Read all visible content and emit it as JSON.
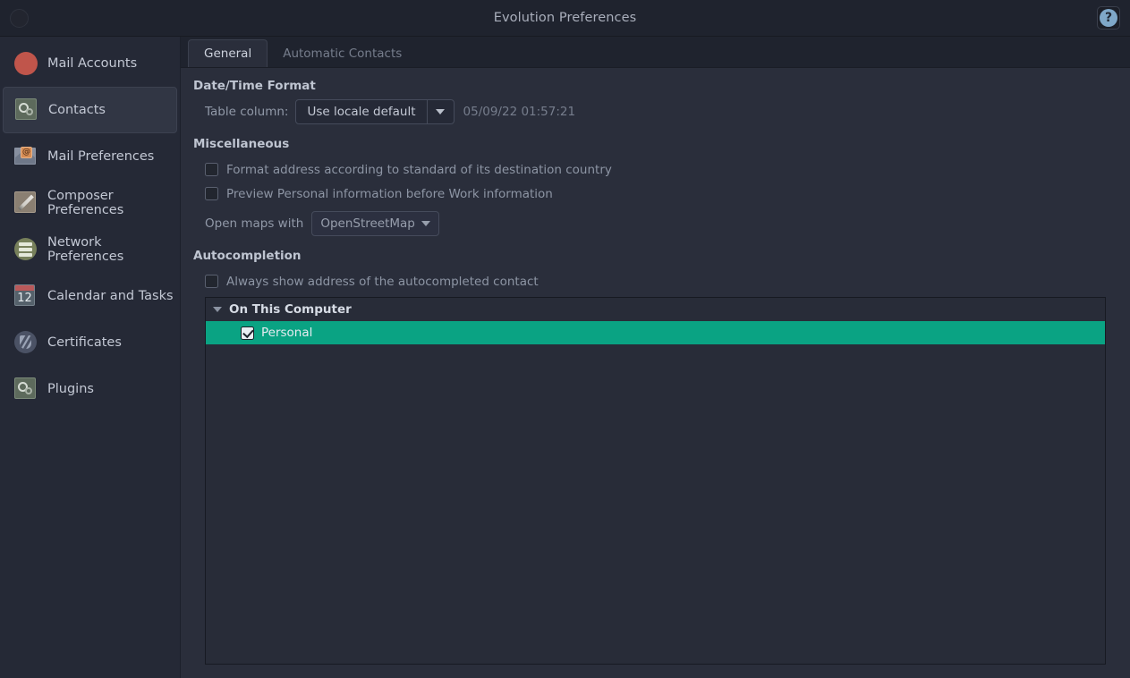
{
  "window": {
    "title": "Evolution Preferences",
    "close_icon": "close-circle-icon",
    "help_icon": "help-question-icon",
    "help_glyph": "?"
  },
  "colors": {
    "selection_green": "#0aa383",
    "window_bg": "#2a2e3b",
    "sidebar_bg": "#252936",
    "titlebar_bg": "#1f232e",
    "accent_red": "#c0554b"
  },
  "sidebar": {
    "items": [
      {
        "label": "Mail Accounts",
        "icon": "mail-accounts-icon",
        "selected": false
      },
      {
        "label": "Contacts",
        "icon": "contacts-gears-icon",
        "selected": true
      },
      {
        "label": "Mail Preferences",
        "icon": "mail-envelope-icon",
        "selected": false
      },
      {
        "label": "Composer Preferences",
        "icon": "composer-pencil-icon",
        "selected": false
      },
      {
        "label": "Network Preferences",
        "icon": "network-server-icon",
        "selected": false
      },
      {
        "label": "Calendar and Tasks",
        "icon": "calendar-icon",
        "selected": false
      },
      {
        "label": "Certificates",
        "icon": "certificate-shield-icon",
        "selected": false
      },
      {
        "label": "Plugins",
        "icon": "plugins-gears-icon",
        "selected": false
      }
    ]
  },
  "tabs": [
    {
      "label": "General",
      "active": true
    },
    {
      "label": "Automatic Contacts",
      "active": false
    }
  ],
  "datetime_section": {
    "title": "Date/Time Format",
    "table_column_label": "Table column:",
    "format_value": "Use locale default",
    "sample_text": "05/09/22 01:57:21"
  },
  "misc_section": {
    "title": "Miscellaneous",
    "checkboxes": [
      {
        "label": "Format address according to standard of its destination country",
        "checked": false
      },
      {
        "label": "Preview Personal information before Work information",
        "checked": false
      }
    ],
    "maps_label": "Open maps with",
    "maps_value": "OpenStreetMap"
  },
  "autocompletion_section": {
    "title": "Autocompletion",
    "checkbox": {
      "label": "Always show address of the autocompleted contact",
      "checked": false
    },
    "tree": {
      "groups": [
        {
          "label": "On This Computer",
          "expanded": true,
          "children": [
            {
              "label": "Personal",
              "checked": true,
              "selected": true
            }
          ]
        }
      ]
    }
  }
}
